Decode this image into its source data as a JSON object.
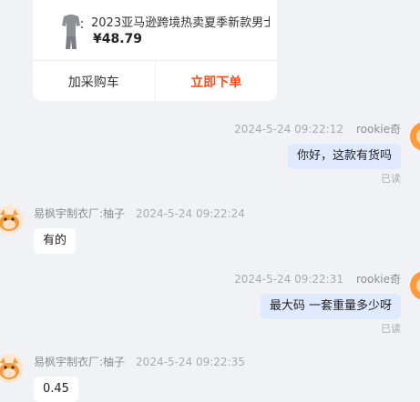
{
  "product": {
    "title": "2023亚马逊跨境热卖夏季新款男士",
    "price": "¥48.79",
    "add_cart_label": "加采购车",
    "buy_now_label": "立即下单"
  },
  "messages": [
    {
      "time": "2024-5-24 09:22:12",
      "sender": "rookie奇",
      "text": "你好，这款有货吗",
      "status": "已读"
    },
    {
      "time": "2024-5-24 09:22:24",
      "sender": "易枫宇制衣厂:柚子",
      "text": "有的"
    },
    {
      "time": "2024-5-24 09:22:31",
      "sender": "rookie奇",
      "text": "最大码  一套重量多少呀",
      "status": "已读"
    },
    {
      "time": "2024-5-24 09:22:35",
      "sender": "易枫宇制衣厂:柚子",
      "text": "0.45"
    }
  ],
  "colors": {
    "accent": "#ff4d1a",
    "outgoing_bubble": "#dfe9ff",
    "incoming_bubble": "#ffffff",
    "background": "#f1f2f6"
  }
}
